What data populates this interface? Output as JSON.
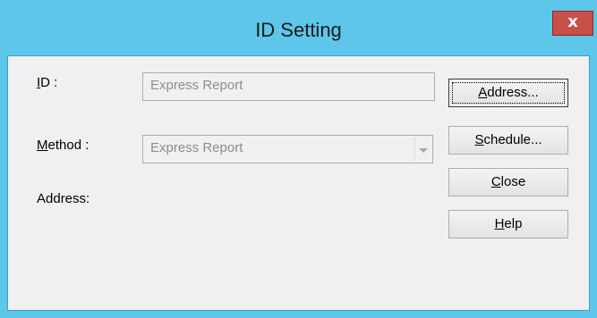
{
  "window": {
    "title": "ID Setting",
    "close_label": "x"
  },
  "form": {
    "id": {
      "label_accel": "I",
      "label_rest": "D :",
      "value": "Express Report"
    },
    "method": {
      "label_accel": "M",
      "label_rest": "ethod :",
      "value": "Express Report"
    },
    "address": {
      "label": "Address:"
    }
  },
  "buttons": {
    "address": {
      "accel": "A",
      "rest": "ddress..."
    },
    "schedule": {
      "accel": "S",
      "rest": "chedule..."
    },
    "close": {
      "accel": "C",
      "rest": "lose"
    },
    "help": {
      "accel": "H",
      "rest": "elp"
    }
  },
  "colors": {
    "titlebar": "#5ec6ea",
    "close_button": "#c7504a",
    "client_bg": "#f0f0f0",
    "disabled_text": "#8d8d8d"
  }
}
